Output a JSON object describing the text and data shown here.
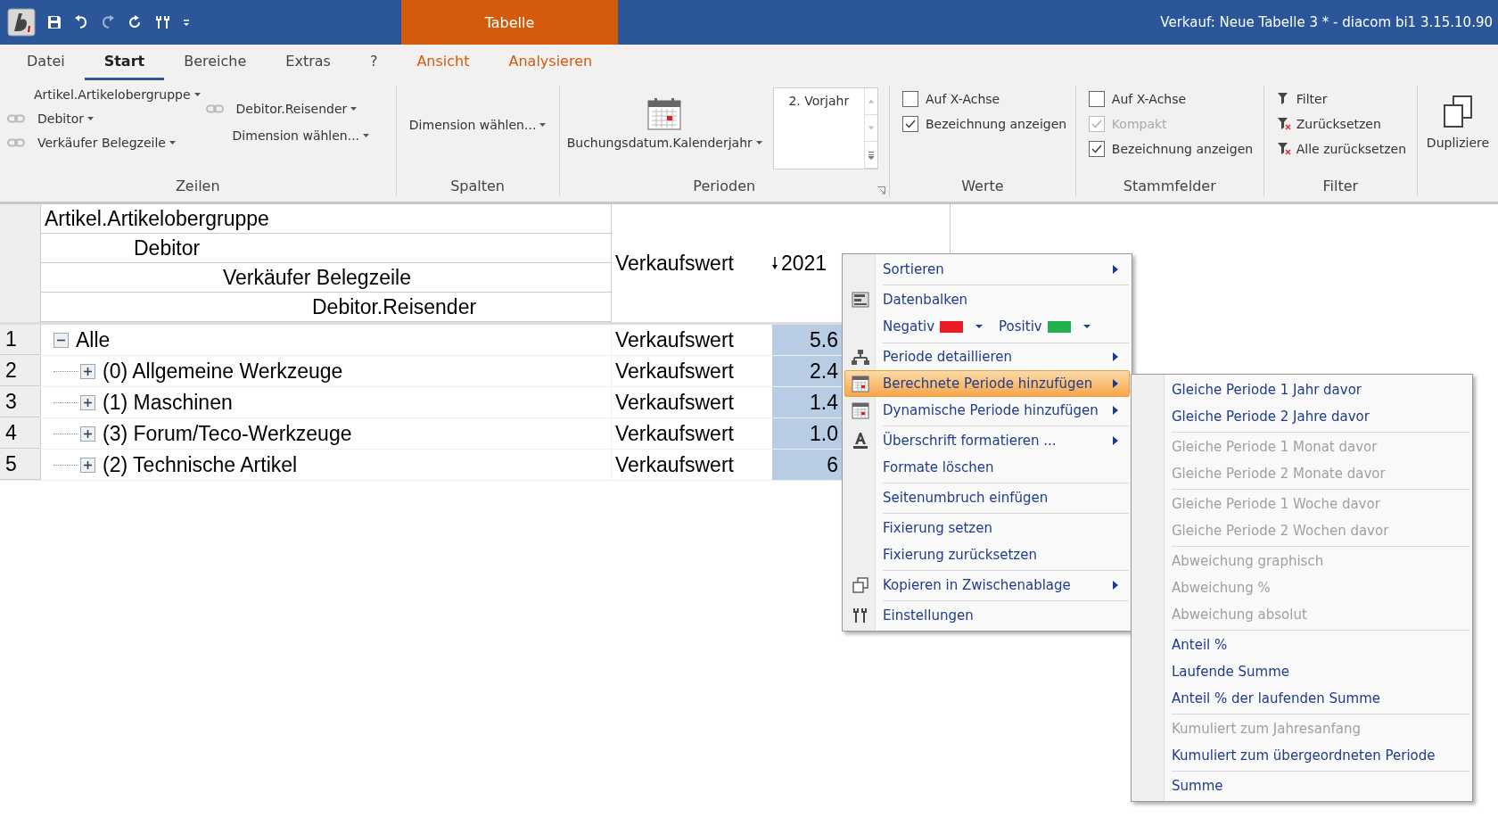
{
  "titlebar": {
    "context_tab": "Tabelle",
    "title": "Verkauf: Neue Tabelle 3 * - diacom bi1 3.15.10.90"
  },
  "tabs": [
    {
      "label": "Datei",
      "selected": false,
      "kind": "normal"
    },
    {
      "label": "Start",
      "selected": true,
      "kind": "normal"
    },
    {
      "label": "Bereiche",
      "selected": false,
      "kind": "normal"
    },
    {
      "label": "Extras",
      "selected": false,
      "kind": "normal"
    },
    {
      "label": "?",
      "selected": false,
      "kind": "normal"
    },
    {
      "label": "Ansicht",
      "selected": false,
      "kind": "context"
    },
    {
      "label": "Analysieren",
      "selected": false,
      "kind": "context"
    }
  ],
  "ribbon": {
    "zeilen": {
      "label": "Zeilen",
      "left": [
        {
          "label": "Artikel.Artikelobergruppe",
          "linked": false
        },
        {
          "label": "Debitor",
          "linked": true
        },
        {
          "label": "Verkäufer Belegzeile",
          "linked": true
        }
      ],
      "right": [
        {
          "label": "Debitor.Reisender",
          "linked": true
        },
        {
          "label": "Dimension wählen...",
          "linked": false
        }
      ]
    },
    "spalten": {
      "label": "Spalten",
      "button": "Dimension wählen..."
    },
    "perioden": {
      "label": "Perioden",
      "button": "Buchungsdatum.Kalenderjahr",
      "list_value": "2. Vorjahr"
    },
    "werte": {
      "label": "Werte",
      "checks": [
        {
          "label": "Auf X-Achse",
          "checked": false,
          "disabled": false
        },
        {
          "label": "Bezeichnung anzeigen",
          "checked": true,
          "disabled": false
        }
      ]
    },
    "stammfelder": {
      "label": "Stammfelder",
      "checks": [
        {
          "label": "Auf X-Achse",
          "checked": false,
          "disabled": false
        },
        {
          "label": "Kompakt",
          "checked": true,
          "disabled": true
        },
        {
          "label": "Bezeichnung anzeigen",
          "checked": true,
          "disabled": false
        }
      ]
    },
    "filter": {
      "label": "Filter",
      "buttons": [
        "Filter",
        "Zurücksetzen",
        "Alle zurücksetzen"
      ]
    },
    "duplicate": "Dupliziere"
  },
  "table": {
    "row_headers": [
      "Artikel.Artikelobergruppe",
      "Debitor",
      "Verkäufer Belegzeile",
      "Debitor.Reisender"
    ],
    "measure_header": "Verkaufswert",
    "period_header": "2021",
    "sort_descending": true,
    "rows": [
      {
        "number": "1",
        "label": "Alle",
        "expanded": true,
        "measure": "Verkaufswert",
        "value": "5.6",
        "children": [
          {
            "number": "2",
            "label": "(0) Allgemeine Werkzeuge",
            "expanded": false,
            "measure": "Verkaufswert",
            "value": "2.4"
          },
          {
            "number": "3",
            "label": "(1) Maschinen",
            "expanded": false,
            "measure": "Verkaufswert",
            "value": "1.4"
          },
          {
            "number": "4",
            "label": "(3) Forum/Teco-Werkzeuge",
            "expanded": false,
            "measure": "Verkaufswert",
            "value": "1.0"
          },
          {
            "number": "5",
            "label": "(2) Technische Artikel",
            "expanded": false,
            "measure": "Verkaufswert",
            "value": "6"
          }
        ]
      }
    ]
  },
  "context_menu": [
    {
      "kind": "item",
      "label": "Sortieren",
      "submenu": true,
      "selected": false,
      "separator_after": true
    },
    {
      "kind": "item",
      "label": "Datenbalken",
      "submenu": false,
      "selected": false,
      "separator_after": false
    },
    {
      "kind": "colors",
      "negative": {
        "label": "Negativ",
        "color": "#ed1c24"
      },
      "positive": {
        "label": "Positiv",
        "color": "#22b14c"
      },
      "separator_after": true
    },
    {
      "kind": "item",
      "label": "Periode detaillieren",
      "submenu": true,
      "selected": false,
      "separator_after": false
    },
    {
      "kind": "item",
      "label": "Berechnete Periode hinzufügen",
      "submenu": true,
      "selected": true,
      "separator_after": false
    },
    {
      "kind": "item",
      "label": "Dynamische Periode hinzufügen",
      "submenu": true,
      "selected": false,
      "separator_after": true
    },
    {
      "kind": "item",
      "label": "Überschrift formatieren ...",
      "submenu": true,
      "selected": false,
      "separator_after": false
    },
    {
      "kind": "item",
      "label": "Formate löschen",
      "submenu": false,
      "selected": false,
      "separator_after": true
    },
    {
      "kind": "item",
      "label": "Seitenumbruch einfügen",
      "submenu": false,
      "selected": false,
      "separator_after": true
    },
    {
      "kind": "item",
      "label": "Fixierung setzen",
      "submenu": false,
      "selected": false,
      "separator_after": false
    },
    {
      "kind": "item",
      "label": "Fixierung zurücksetzen",
      "submenu": false,
      "selected": false,
      "separator_after": true
    },
    {
      "kind": "item",
      "label": "Kopieren in Zwischenablage",
      "submenu": true,
      "selected": false,
      "separator_after": true
    },
    {
      "kind": "item",
      "label": "Einstellungen",
      "submenu": false,
      "selected": false,
      "separator_after": false
    }
  ],
  "submenu": [
    {
      "label": "Gleiche Periode 1 Jahr davor",
      "disabled": false,
      "separator_after": false
    },
    {
      "label": "Gleiche Periode 2 Jahre davor",
      "disabled": false,
      "separator_after": true
    },
    {
      "label": "Gleiche Periode 1 Monat davor",
      "disabled": true,
      "separator_after": false
    },
    {
      "label": "Gleiche Periode 2 Monate davor",
      "disabled": true,
      "separator_after": true
    },
    {
      "label": "Gleiche Periode 1 Woche davor",
      "disabled": true,
      "separator_after": false
    },
    {
      "label": "Gleiche Periode 2 Wochen davor",
      "disabled": true,
      "separator_after": true
    },
    {
      "label": "Abweichung graphisch",
      "disabled": true,
      "separator_after": false
    },
    {
      "label": "Abweichung %",
      "disabled": true,
      "separator_after": false
    },
    {
      "label": "Abweichung absolut",
      "disabled": true,
      "separator_after": true
    },
    {
      "label": "Anteil %",
      "disabled": false,
      "separator_after": false
    },
    {
      "label": "Laufende Summe",
      "disabled": false,
      "separator_after": false
    },
    {
      "label": "Anteil % der laufenden Summe",
      "disabled": false,
      "separator_after": true
    },
    {
      "label": "Kumuliert zum Jahresanfang",
      "disabled": true,
      "separator_after": false
    },
    {
      "label": "Kumuliert zum übergeordneten Periode",
      "disabled": false,
      "separator_after": true
    },
    {
      "label": "Summe",
      "disabled": false,
      "separator_after": false
    }
  ]
}
